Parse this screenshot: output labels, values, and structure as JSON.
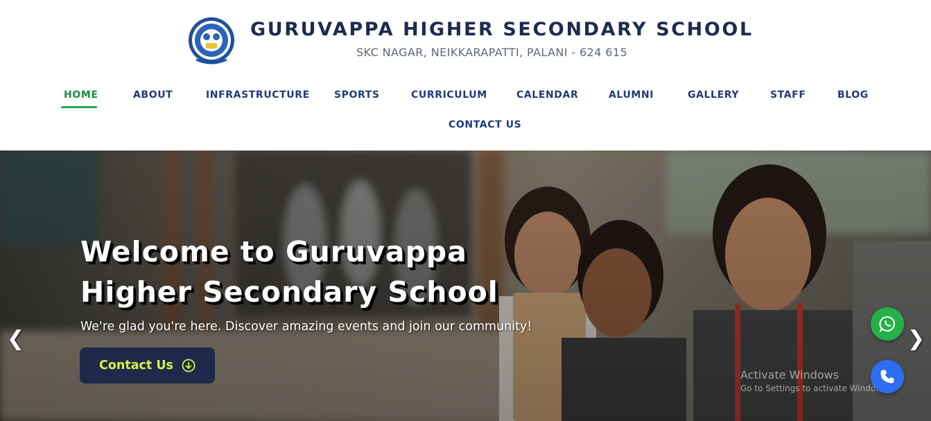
{
  "header": {
    "school_name": "GURUVAPPA HIGHER SECONDARY SCHOOL",
    "address": "SKC NAGAR, NEIKKARAPATTI, PALANI - 624 615",
    "logo_icon": "school-crest-logo"
  },
  "nav": {
    "items": [
      {
        "label": "HOME",
        "active": true
      },
      {
        "label": "ABOUT"
      },
      {
        "label": "INFRASTRUCTURE"
      },
      {
        "label": "SPORTS"
      },
      {
        "label": "CURRICULUM"
      },
      {
        "label": "CALENDAR"
      },
      {
        "label": "ALUMNI"
      },
      {
        "label": "GALLERY"
      },
      {
        "label": "STAFF"
      },
      {
        "label": "BLOG"
      },
      {
        "label": "CONTACT US"
      }
    ]
  },
  "hero": {
    "title_line1": "Welcome to Guruvappa",
    "title_line2": "Higher Secondary School",
    "subtitle": "We're glad you're here. Discover amazing events and join our community!",
    "button_label": "Contact Us",
    "button_icon": "arrow-down-circle-icon",
    "prev_arrow": "❮",
    "next_arrow": "❯",
    "background": "photo of smiling schoolgirls in uniform"
  },
  "floating": {
    "whatsapp_icon": "whatsapp-icon",
    "phone_icon": "phone-icon"
  },
  "watermark": {
    "title": "Activate Windows",
    "subtitle": "Go to Settings to activate Windows."
  },
  "colors": {
    "brand_navy": "#1d2b4f",
    "nav_blue": "#1f3a7a",
    "nav_active": "#1f8a43",
    "button_bg": "#1e2a4a",
    "button_text": "#d4f542",
    "whatsapp": "#25b14a",
    "phone": "#2f6df0"
  }
}
